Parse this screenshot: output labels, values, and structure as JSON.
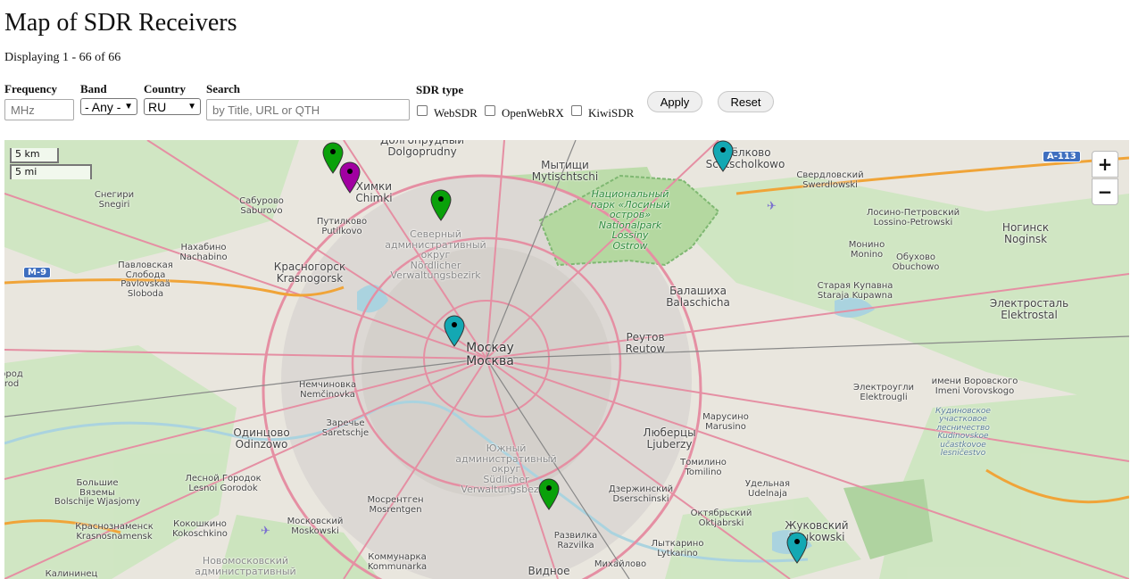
{
  "page": {
    "title": "Map of SDR Receivers",
    "count_text": "Displaying 1 - 66 of 66"
  },
  "filters": {
    "frequency": {
      "label": "Frequency",
      "placeholder": "MHz"
    },
    "band": {
      "label": "Band",
      "value": "- Any -"
    },
    "country": {
      "label": "Country",
      "value": "RU"
    },
    "search": {
      "label": "Search",
      "placeholder": "by Title, URL or QTH"
    },
    "sdr_type": {
      "label": "SDR type",
      "options": [
        "WebSDR",
        "OpenWebRX",
        "KiwiSDR"
      ]
    },
    "apply_label": "Apply",
    "reset_label": "Reset"
  },
  "map": {
    "zoom_in": "+",
    "zoom_out": "−",
    "scale_km": "5 km",
    "scale_mi": "5 mi",
    "shield_a113": "A-113",
    "shield_m9": "M-9",
    "places": [
      {
        "text": "Долгопрудный\nDolgoprudny"
      },
      {
        "text": "Мытищи\nMytischtschi"
      },
      {
        "text": "Щёлково\nSchtscholkowo"
      },
      {
        "text": "Снегири\nSnegiri"
      },
      {
        "text": "Сабурово\nSaburovo"
      },
      {
        "text": "Химки\nChimki"
      },
      {
        "text": "Путилково\nPutilkovo"
      },
      {
        "text": "Свердловский\nSwerdlowski"
      },
      {
        "text": "Лосино-Петровский\nLossino-Petrowski"
      },
      {
        "text": "Национальный\nпарк «Лосиный\nостров»\nNationalpark\nLossiny\nOstrow"
      },
      {
        "text": "Северный\nадминистративный\nокруг\nNördlicher\nVerwaltungsbezirk"
      },
      {
        "text": "Нахабино\nNachabino"
      },
      {
        "text": "Павловская\nСлобода\nPavlovskaä\nSloboda"
      },
      {
        "text": "Красногорск\nKrasnogorsk"
      },
      {
        "text": "Ногинск\nNoginsk"
      },
      {
        "text": "Монино\nMonino"
      },
      {
        "text": "Обухово\nObuchowo"
      },
      {
        "text": "Старая Купавна\nStaraja Kupawna"
      },
      {
        "text": "Балашиха\nBalaschicha"
      },
      {
        "text": "Электросталь\nElektrostal"
      },
      {
        "text": "Москау\nМосква"
      },
      {
        "text": "Реутов\nReutow"
      },
      {
        "text": "Немчиновка\nNemčinovka"
      },
      {
        "text": "Заречье\nSaretschje"
      },
      {
        "text": "Электроугли\nElektrougli"
      },
      {
        "text": "имени Воровского\nImeni Vorovskogo"
      },
      {
        "text": "Одинцово\nOdinzowo"
      },
      {
        "text": "Марусино\nMarusino"
      },
      {
        "text": "Люберцы\nLjuberzy"
      },
      {
        "text": "Южный\nадминистративный\nокруг\nSüdlicher\nVerwaltungsbezirk"
      },
      {
        "text": "Кудиновское\nучастковое\nлесничество\nKudinovskoe\nučastkovoe\nlesničestvo"
      },
      {
        "text": "Томилино\nTomilino"
      },
      {
        "text": "Большие\nВяземы\nBolschije Wjasjomy"
      },
      {
        "text": "Лесной Городок\nLesnoi Gorodok"
      },
      {
        "text": "Мосрентген\nMosrentgen"
      },
      {
        "text": "Дзержинский\nDserschinski"
      },
      {
        "text": "Удельная\nUdelnaja"
      },
      {
        "text": "Октябрьский\nOktjabrski"
      },
      {
        "text": "Жуковский\nShukowski"
      },
      {
        "text": "Краснознаменск\nKrasnosnamensk"
      },
      {
        "text": "Кокошкино\nKokoschkino"
      },
      {
        "text": "Московский\nMoskowski"
      },
      {
        "text": "Развилка\nRazvilka"
      },
      {
        "text": "Лыткарино\nLytkarino"
      },
      {
        "text": "Новомосковский\nадминистративный"
      },
      {
        "text": "Коммунарка\nKommunarka"
      },
      {
        "text": "Видное"
      },
      {
        "text": "Михайлово"
      },
      {
        "text": "Калининец"
      },
      {
        "text": "ород\nrod"
      }
    ],
    "markers": [
      {
        "type": "KiwiSDR",
        "color": "#0aa10a"
      },
      {
        "type": "WebSDR",
        "color": "#a100a1"
      },
      {
        "type": "KiwiSDR",
        "color": "#0aa10a"
      },
      {
        "type": "OpenWebRX",
        "color": "#13a8b3"
      },
      {
        "type": "OpenWebRX",
        "color": "#13a8b3"
      },
      {
        "type": "KiwiSDR",
        "color": "#0aa10a"
      },
      {
        "type": "OpenWebRX",
        "color": "#13a8b3"
      }
    ]
  }
}
